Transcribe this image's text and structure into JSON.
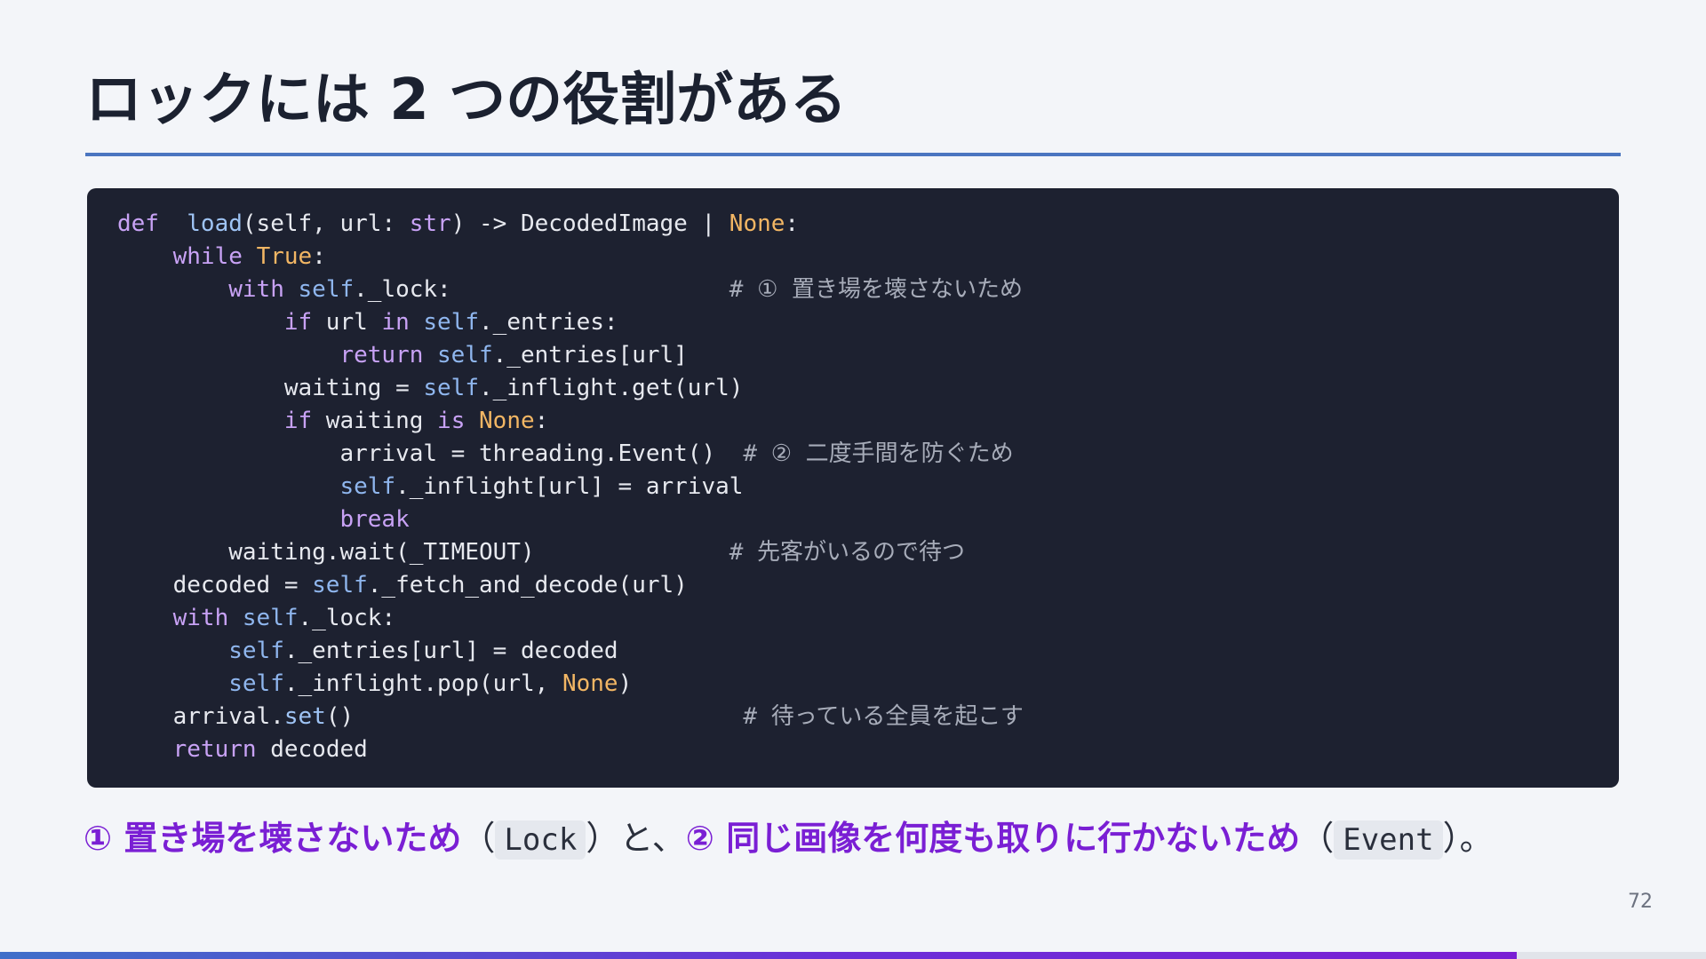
{
  "slide": {
    "title": "ロックには 2 つの役割がある",
    "page_number": "72",
    "progress_fraction": 0.889,
    "colors": {
      "accent_blue": "#4a75c0",
      "accent_purple": "#7a1fd4",
      "code_background": "#1d2130"
    }
  },
  "code": {
    "lines": [
      [
        [
          "kw",
          "def"
        ],
        [
          "",
          "  "
        ],
        [
          "fn",
          "load"
        ],
        [
          "",
          "(self, url: "
        ],
        [
          "bi",
          "str"
        ],
        [
          "",
          ") -> DecodedImage | "
        ],
        [
          "cst",
          "None"
        ],
        [
          "",
          ":"
        ]
      ],
      [
        [
          "",
          "    "
        ],
        [
          "kw",
          "while"
        ],
        [
          "",
          " "
        ],
        [
          "cst",
          "True"
        ],
        [
          "",
          ":"
        ]
      ],
      [
        [
          "",
          "        "
        ],
        [
          "kw",
          "with"
        ],
        [
          "",
          " "
        ],
        [
          "slf",
          "self"
        ],
        [
          "",
          "._lock:                    "
        ],
        [
          "cm",
          "# ① 置き場を壊さないため"
        ]
      ],
      [
        [
          "",
          "            "
        ],
        [
          "kw",
          "if"
        ],
        [
          "",
          " url "
        ],
        [
          "kw",
          "in"
        ],
        [
          "",
          " "
        ],
        [
          "slf",
          "self"
        ],
        [
          "",
          "._entries:"
        ]
      ],
      [
        [
          "",
          "                "
        ],
        [
          "kw",
          "return"
        ],
        [
          "",
          " "
        ],
        [
          "slf",
          "self"
        ],
        [
          "",
          "._entries[url]"
        ]
      ],
      [
        [
          "",
          "            waiting = "
        ],
        [
          "slf",
          "self"
        ],
        [
          "",
          "._inflight.get(url)"
        ]
      ],
      [
        [
          "",
          "            "
        ],
        [
          "kw",
          "if"
        ],
        [
          "",
          " waiting "
        ],
        [
          "kw",
          "is"
        ],
        [
          "",
          " "
        ],
        [
          "cst",
          "None"
        ],
        [
          "",
          ":"
        ]
      ],
      [
        [
          "",
          "                arrival = threading.Event()  "
        ],
        [
          "cm",
          "# ② 二度手間を防ぐため"
        ]
      ],
      [
        [
          "",
          "                "
        ],
        [
          "slf",
          "self"
        ],
        [
          "",
          "._inflight[url] = arrival"
        ]
      ],
      [
        [
          "",
          "                "
        ],
        [
          "kw",
          "break"
        ]
      ],
      [
        [
          "",
          "        waiting.wait(_TIMEOUT)              "
        ],
        [
          "cm",
          "# 先客がいるので待つ"
        ]
      ],
      [
        [
          "",
          "    decoded = "
        ],
        [
          "slf",
          "self"
        ],
        [
          "",
          "._fetch_and_decode(url)"
        ]
      ],
      [
        [
          "",
          "    "
        ],
        [
          "kw",
          "with"
        ],
        [
          "",
          " "
        ],
        [
          "slf",
          "self"
        ],
        [
          "",
          "._lock:"
        ]
      ],
      [
        [
          "",
          "        "
        ],
        [
          "slf",
          "self"
        ],
        [
          "",
          "._entries[url] = decoded"
        ]
      ],
      [
        [
          "",
          "        "
        ],
        [
          "slf",
          "self"
        ],
        [
          "",
          "._inflight.pop(url, "
        ],
        [
          "cst",
          "None"
        ],
        [
          "",
          ")"
        ]
      ],
      [
        [
          "",
          "    arrival."
        ],
        [
          "fn",
          "set"
        ],
        [
          "",
          "()                            "
        ],
        [
          "cm",
          "# 待っている全員を起こす"
        ]
      ],
      [
        [
          "",
          "    "
        ],
        [
          "kw",
          "return"
        ],
        [
          "",
          " decoded"
        ]
      ]
    ]
  },
  "caption": {
    "part1_highlight": "① 置き場を壊さないため",
    "part1_open": "（",
    "part1_code": "Lock",
    "part1_close": "）と、",
    "part2_highlight": "② 同じ画像を何度も取りに行かないため",
    "part2_open": "（",
    "part2_code": "Event",
    "part2_close": "）。"
  }
}
